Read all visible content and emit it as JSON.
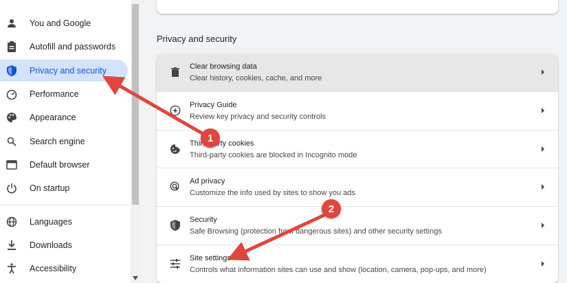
{
  "sidebar": {
    "items": [
      {
        "label": "You and Google",
        "icon": "person-icon"
      },
      {
        "label": "Autofill and passwords",
        "icon": "clipboard-icon"
      },
      {
        "label": "Privacy and security",
        "icon": "shield-icon",
        "active": true
      },
      {
        "label": "Performance",
        "icon": "speedometer-icon"
      },
      {
        "label": "Appearance",
        "icon": "palette-icon"
      },
      {
        "label": "Search engine",
        "icon": "search-icon"
      },
      {
        "label": "Default browser",
        "icon": "browser-window-icon"
      },
      {
        "label": "On startup",
        "icon": "power-icon"
      },
      {
        "label": "Languages",
        "icon": "globe-icon"
      },
      {
        "label": "Downloads",
        "icon": "download-icon"
      },
      {
        "label": "Accessibility",
        "icon": "accessibility-icon"
      }
    ]
  },
  "main": {
    "section_title": "Privacy and security",
    "rows": [
      {
        "title": "Clear browsing data",
        "subtitle": "Clear history, cookies, cache, and more",
        "icon": "trash-icon"
      },
      {
        "title": "Privacy Guide",
        "subtitle": "Review key privacy and security controls",
        "icon": "compass-icon"
      },
      {
        "title": "Third-party cookies",
        "subtitle": "Third-party cookies are blocked in Incognito mode",
        "icon": "cookie-icon"
      },
      {
        "title": "Ad privacy",
        "subtitle": "Customize the info used by sites to show you ads",
        "icon": "ad-privacy-icon"
      },
      {
        "title": "Security",
        "subtitle": "Safe Browsing (protection from dangerous sites) and other security settings",
        "icon": "security-shield-icon"
      },
      {
        "title": "Site settings",
        "subtitle": "Controls what information sites can use and show (location, camera, pop-ups, and more)",
        "icon": "sliders-icon"
      }
    ]
  },
  "annotations": {
    "badge1": "1",
    "badge2": "2",
    "color": "#e0463e"
  },
  "colors": {
    "accent": "#0b57d0",
    "active_bg": "#d3e3fd"
  }
}
